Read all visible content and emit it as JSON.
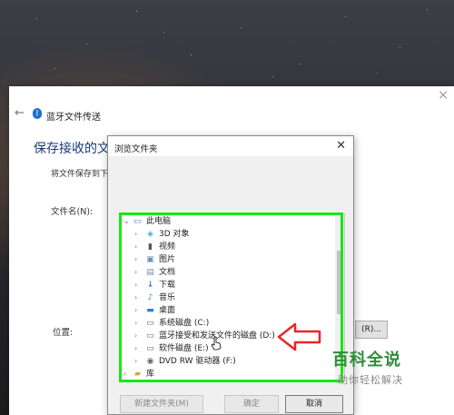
{
  "bluetooth_window": {
    "title": "蓝牙文件传送",
    "heading": "保存接收的文件",
    "save_to_text": "将文件保存到下",
    "filename_label": "文件名(N):",
    "location_label": "位置:",
    "browse_button": "(R)..."
  },
  "browse_dialog": {
    "title": "浏览文件夹",
    "close_glyph": "✕",
    "tree": [
      {
        "label": "此电脑",
        "icon": "pc-icon",
        "level": 0,
        "expanded": true
      },
      {
        "label": "3D 对象",
        "icon": "3d-objects-icon",
        "level": 1
      },
      {
        "label": "视频",
        "icon": "video-icon",
        "level": 1
      },
      {
        "label": "图片",
        "icon": "pictures-icon",
        "level": 1
      },
      {
        "label": "文档",
        "icon": "documents-icon",
        "level": 1
      },
      {
        "label": "下载",
        "icon": "download-icon",
        "level": 1
      },
      {
        "label": "音乐",
        "icon": "music-icon",
        "level": 1
      },
      {
        "label": "桌面",
        "icon": "desktop-icon",
        "level": 1
      },
      {
        "label": "系统磁盘 (C:)",
        "icon": "drive-icon",
        "level": 1
      },
      {
        "label": "蓝牙接受和发送文件的磁盘 (D:)",
        "icon": "drive-icon",
        "level": 1
      },
      {
        "label": "软件磁盘 (E:)",
        "icon": "drive-icon",
        "level": 1
      },
      {
        "label": "DVD RW 驱动器 (F:)",
        "icon": "dvd-icon",
        "level": 1
      },
      {
        "label": "库",
        "icon": "library-icon",
        "level": 0
      }
    ],
    "buttons": {
      "new_folder": "新建文件夹(M)",
      "ok": "确定",
      "cancel": "取消"
    }
  },
  "watermark": {
    "logo": "百科全说",
    "slogan": "助你轻松解决"
  },
  "colors": {
    "highlight_box": "#19e619",
    "annotation_arrow": "#e8262b",
    "watermark_green": "#2e8b3a",
    "heading_blue": "#1a3a7a"
  }
}
